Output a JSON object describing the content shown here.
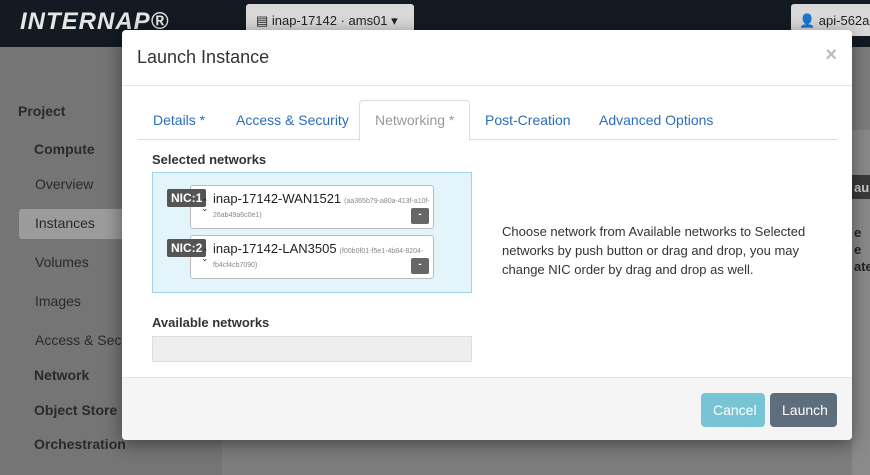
{
  "app": {
    "logo": "INTERNAP®",
    "project_selector": "▤ inap-17142 · ams01 ▾",
    "user_menu": "👤 api-562a"
  },
  "sidebar": {
    "project": "Project",
    "compute": "Compute",
    "items": [
      "Overview",
      "Instances",
      "Volumes",
      "Images",
      "Access & Secu"
    ],
    "network": "Network",
    "object_store": "Object Store",
    "orchestration": "Orchestration"
  },
  "right_strip": {
    "button": "aunc",
    "lines": [
      "e",
      "e",
      "ated"
    ]
  },
  "modal": {
    "title": "Launch Instance",
    "close": "×",
    "tabs": [
      "Details *",
      "Access & Security",
      "Networking *",
      "Post-Creation",
      "Advanced Options"
    ],
    "active_tab": "Networking *",
    "selected_label": "Selected networks",
    "selected_networks": [
      {
        "nic": "NIC:1",
        "name": "inap-17142-WAN1521",
        "id_part1": "(aa365b79-a80a-413f-a10f-",
        "id_part2": "26ab49a6c0e1)",
        "remove": "-"
      },
      {
        "nic": "NIC:2",
        "name": "inap-17142-LAN3505",
        "id_part1": "(f00b0f01-f5e1-4b84-8204-",
        "id_part2": "fb4cf4cb7090)",
        "remove": "-"
      }
    ],
    "help_text": "Choose network from Available networks to Selected networks by push button or drag and drop, you may change NIC order by drag and drop as well.",
    "available_label": "Available networks",
    "cancel": "Cancel",
    "launch": "Launch"
  },
  "colors": {
    "link": "#2a6ebb",
    "cancel_button": "#77c5d4",
    "launch_button": "#5f6e7c",
    "selected_bg": "#e4f4fb"
  },
  "icons": {
    "close": "close-icon",
    "sort": "sort-arrows-icon",
    "remove": "minus-icon"
  }
}
